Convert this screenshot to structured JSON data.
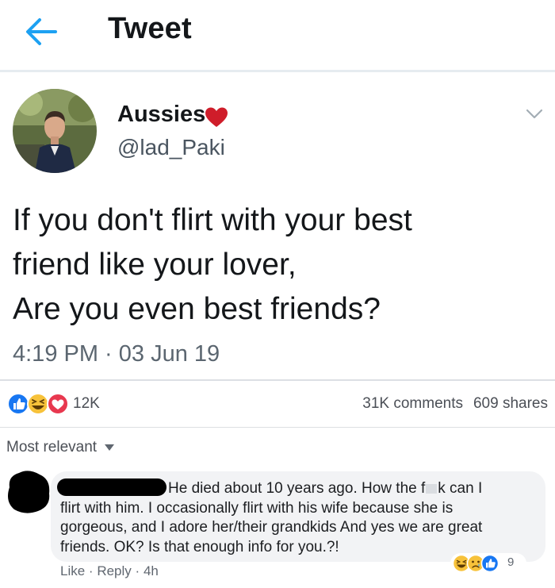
{
  "header": {
    "title": "Tweet",
    "back_icon": "arrow-left-icon",
    "accent": "#1da1f2"
  },
  "tweet": {
    "display_name": "Aussies",
    "name_emoji": "red-heart-icon",
    "handle": "@lad_Paki",
    "lines": [
      "If you don't flirt with your best",
      "friend like your lover,",
      "Are you even best friends?"
    ],
    "timestamp": "4:19 PM · 03 Jun 19"
  },
  "reactions_bar": {
    "icons": [
      "like-icon",
      "haha-icon",
      "love-icon"
    ],
    "count": "12K",
    "comments": "31K comments",
    "shares": "609 shares"
  },
  "sort": {
    "label": "Most relevant"
  },
  "comment": {
    "text_line1_a": "He died about 10 years ago. How the f",
    "text_line1_b": "k can I",
    "text_lines": [
      "flirt with him. I occasionally flirt with his wife because she is",
      "gorgeous, and I adore her/their grandkids And yes we are great",
      "friends. OK? Is that enough info for you.?!"
    ],
    "actions": {
      "like": "Like",
      "separator": "·",
      "reply": "Reply",
      "time": "4h"
    },
    "reaction_icons": [
      "haha-icon",
      "sad-icon",
      "like-icon"
    ],
    "reaction_count": "9"
  }
}
